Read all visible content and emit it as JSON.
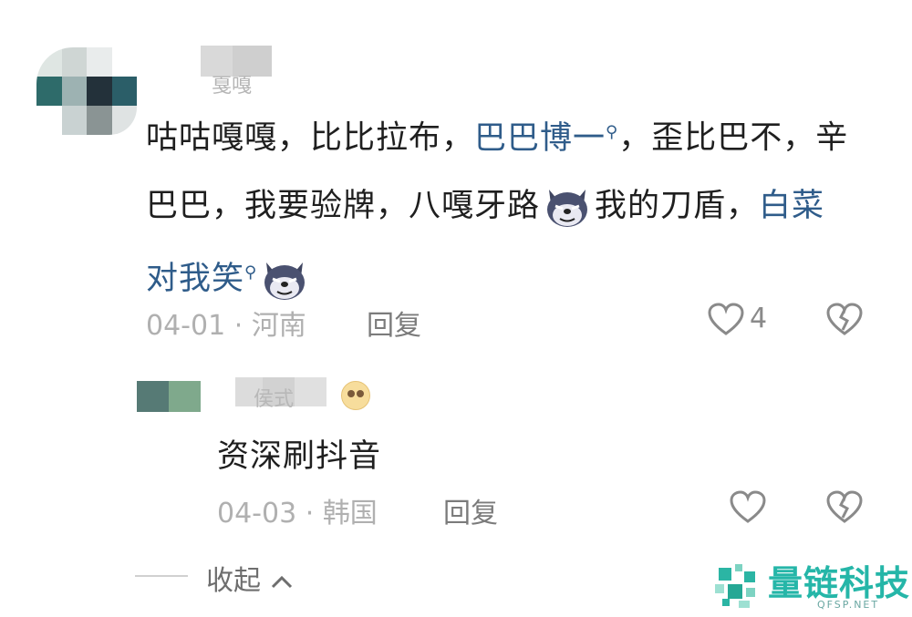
{
  "comment": {
    "name_tail": "戛嘎",
    "text_parts": [
      {
        "type": "text",
        "value": "咕咕嘎嘎，比比拉布，"
      },
      {
        "type": "link",
        "value": "巴巴博一"
      },
      {
        "type": "text",
        "value": "，歪比巴不，辛巴巴，我要验牌，八嘎牙路"
      },
      {
        "type": "emoji",
        "value": "wolf-emoji"
      },
      {
        "type": "text",
        "value": "我的刀盾，"
      },
      {
        "type": "link",
        "value": "白菜对我笑"
      },
      {
        "type": "emoji",
        "value": "wolf-emoji"
      }
    ],
    "date": "04-01",
    "location": "河南",
    "reply_label": "回复",
    "likes": "4"
  },
  "reply": {
    "name_tail": "侯式",
    "text": "资深刷抖音",
    "date": "04-03",
    "location": "韩国",
    "reply_label": "回复"
  },
  "collapse_label": "收起",
  "watermark": {
    "name": "量链科技",
    "sub": "QFSP.NET"
  },
  "colors": {
    "link": "#2f5c8a",
    "meta": "#b0b0b0",
    "watermark": "#25b6a8"
  }
}
